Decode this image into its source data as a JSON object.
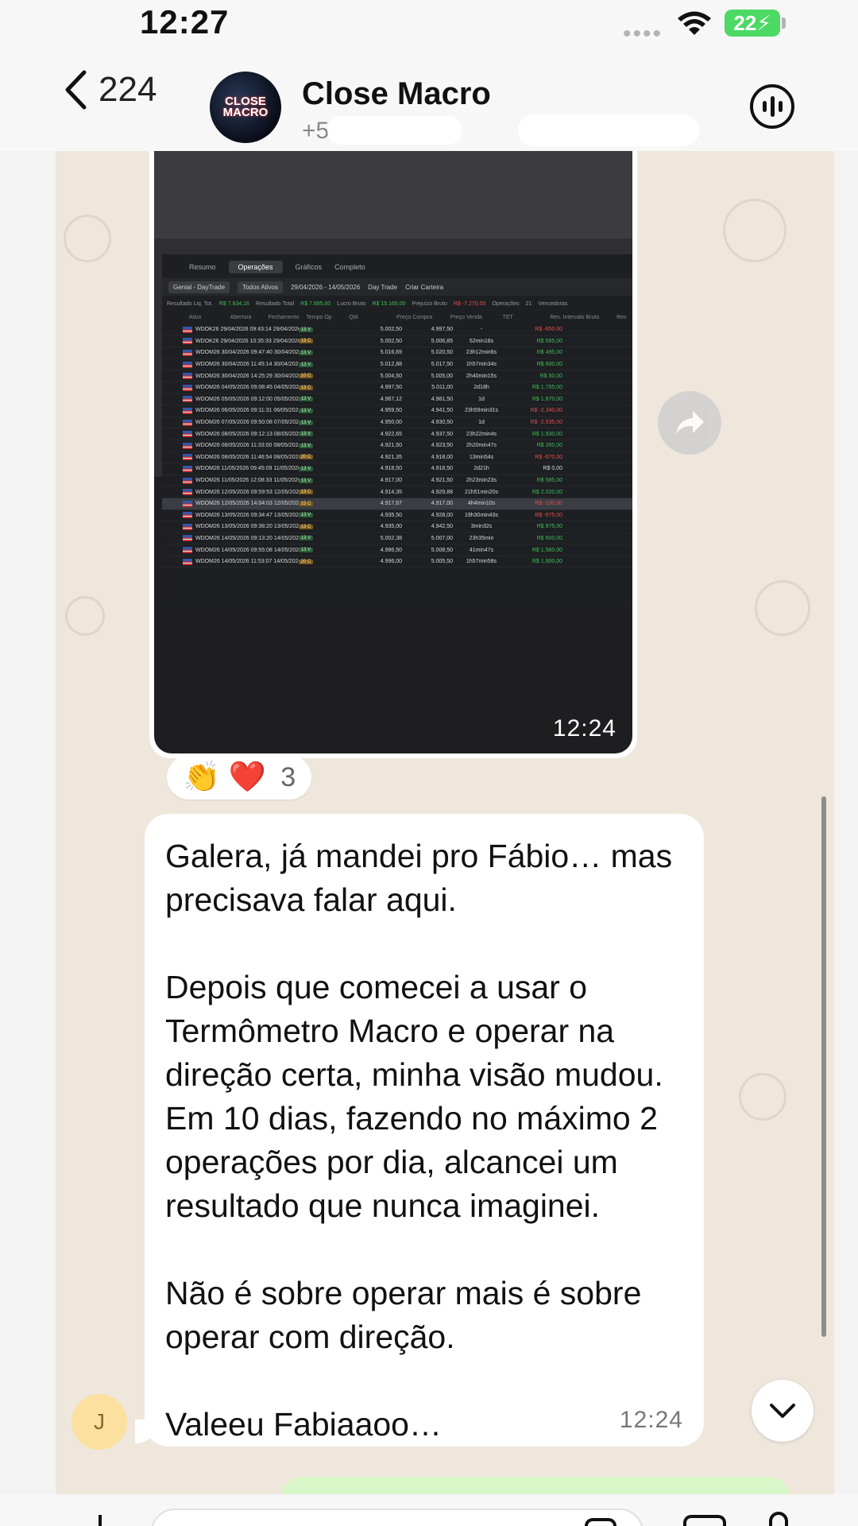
{
  "status_bar": {
    "time": "12:27",
    "battery": "22"
  },
  "header": {
    "back_count": "224",
    "contact_name": "Close Macro",
    "contact_sub": "+5 19,",
    "avatar_text": "CLOSE MACRO"
  },
  "image_message": {
    "time": "12:24",
    "screenshot": {
      "tabs": [
        "Resumo",
        "Operações",
        "Gráficos",
        "Completo"
      ],
      "active_tab": "Operações",
      "toolbar": {
        "account": "Genial - DayTrade",
        "assets": "Todos Ativos",
        "date_range": "29/04/2026 - 14/05/2026",
        "day_trade": "Day Trade",
        "create_wallet": "Criar Carteira"
      },
      "summary": [
        {
          "label": "Resultado Liq. Tot.",
          "value": "R$ 7.834,16",
          "tone": "pos"
        },
        {
          "label": "Resultado Total",
          "value": "R$ 7.895,00",
          "tone": "pos"
        },
        {
          "label": "Lucro Bruto",
          "value": "R$ 15.165,00",
          "tone": "pos"
        },
        {
          "label": "Prejuízo Bruto",
          "value": "R$ -7.270,00",
          "tone": "neg"
        },
        {
          "label": "Operações",
          "value": "21",
          "tone": ""
        },
        {
          "label": "Vencedoras",
          "value": "",
          "tone": ""
        }
      ],
      "columns": [
        "Ativo",
        "Abertura",
        "Fechamento",
        "Tempo Op",
        "Qtd",
        "Preço Compra",
        "Preço Venda",
        "TET",
        "Res. Intervalo Bruto",
        "Res"
      ],
      "rows": [
        {
          "ativo": "WDOK26 29/04/2026 09:43:14 29/04/2026 10:35:52min15s",
          "qtd": "13 V",
          "side": "v",
          "compra": "5.002,50",
          "venda": "4.997,50",
          "tet": "-",
          "res": "R$ -650,00",
          "tone": "neg"
        },
        {
          "ativo": "WDOK26 29/04/2026 10:35:33 29/04/2026 17:03:6h27min",
          "qtd": "13 C",
          "side": "c",
          "compra": "5.002,50",
          "venda": "5.006,85",
          "tet": "52min18s",
          "res": "R$ 565,00",
          "tone": "pos"
        },
        {
          "ativo": "WDOM26 30/04/2026 09:47:40 30/04/2026 11:37:1h49min",
          "qtd": "13 V",
          "side": "v",
          "compra": "5.016,69",
          "venda": "5.020,50",
          "tet": "23h12min6s",
          "res": "R$ 495,00",
          "tone": "pos"
        },
        {
          "ativo": "WDOM26 30/04/2026 11:45:14 30/04/2026 13:01:1h16min",
          "qtd": "13 V",
          "side": "v",
          "compra": "5.012,88",
          "venda": "5.017,50",
          "tet": "1h57min34s",
          "res": "R$ 600,00",
          "tone": "pos"
        },
        {
          "ativo": "WDOM26 30/04/2026 14:25:29 30/04/2026 14:29 3min59s",
          "qtd": "10 C",
          "side": "c",
          "compra": "5.004,50",
          "venda": "5.005,00",
          "tet": "2h40min15s",
          "res": "R$ 50,00",
          "tone": "pos"
        },
        {
          "ativo": "WDOM26 04/05/2026 09:08:45 04/05/2026 14:01:4h53min",
          "qtd": "13 C",
          "side": "c",
          "compra": "4.997,50",
          "venda": "5.011,00",
          "tet": "2d18h",
          "res": "R$ 1.755,00",
          "tone": "pos"
        },
        {
          "ativo": "WDOM26 05/05/2026 09:12:00 05/05/2026 10:19:1h7min",
          "qtd": "13 V",
          "side": "v",
          "compra": "4.967,12",
          "venda": "4.981,50",
          "tet": "1d",
          "res": "R$ 1.870,00",
          "tone": "pos"
        },
        {
          "ativo": "WDOM26 06/05/2026 09:11:31 06/05/2026 10:00 49min",
          "qtd": "13 V",
          "side": "v",
          "compra": "4.959,50",
          "venda": "4.941,50",
          "tet": "23h59min31s",
          "res": "R$ -2.340,00",
          "tone": "neg"
        },
        {
          "ativo": "WDOM26 07/05/2026 09:50:08 07/05/2026 11:03:1h13min",
          "qtd": "13 V",
          "side": "v",
          "compra": "4.950,00",
          "venda": "4.930,50",
          "tet": "1d",
          "res": "R$ -2.535,00",
          "tone": "neg"
        },
        {
          "ativo": "WDOM26 08/05/2026 09:12:13 08/05/2026 10:34:1h21min",
          "qtd": "13 V",
          "side": "v",
          "compra": "4.922,65",
          "venda": "4.937,50",
          "tet": "23h22min4s",
          "res": "R$ 1.930,00",
          "tone": "pos"
        },
        {
          "ativo": "WDOM26 08/05/2026 11:33:00 08/05/2026 11:46 13min53s",
          "qtd": "13 V",
          "side": "v",
          "compra": "4.921,50",
          "venda": "4.923,50",
          "tet": "2h20min47s",
          "res": "R$ 260,00",
          "tone": "pos"
        },
        {
          "ativo": "WDOM26 08/05/2026 11:46:54 08/05/2026 17:34:5h47min",
          "qtd": "20 C",
          "side": "c",
          "compra": "4.921,35",
          "venda": "4.918,00",
          "tet": "13min54s",
          "res": "R$ -670,00",
          "tone": "neg"
        },
        {
          "ativo": "WDOM26 11/05/2026 09:45:09 11/05/2026 11:48:2h3min",
          "qtd": "13 V",
          "side": "v",
          "compra": "4.918,50",
          "venda": "4.918,50",
          "tet": "2d21h",
          "res": "R$ 0,00",
          "tone": "zero"
        },
        {
          "ativo": "WDOM26 11/05/2026 12:08:33 11/05/2026 17:29:5h21min",
          "qtd": "13 V",
          "side": "v",
          "compra": "4.917,00",
          "venda": "4.921,50",
          "tet": "2h23min23s",
          "res": "R$ 585,00",
          "tone": "pos"
        },
        {
          "ativo": "WDOM26 12/05/2026 09:59:53 12/05/2026 12:16:2h16min",
          "qtd": "13 C",
          "side": "c",
          "compra": "4.914,35",
          "venda": "4.929,88",
          "tet": "21h51min20s",
          "res": "R$ 2.020,00",
          "tone": "pos"
        },
        {
          "ativo": "WDOM26 12/05/2026 14:04:03 12/05/2026 17:22:3h18min",
          "qtd": "15 C",
          "side": "c",
          "compra": "4.917,67",
          "venda": "4.917,00",
          "tet": "4h4min10s",
          "res": "R$ -100,00",
          "tone": "neg",
          "selected": true
        },
        {
          "ativo": "WDOM26 13/05/2026 09:34:47 13/05/2026 09:38 3min28s",
          "qtd": "13 V",
          "side": "v",
          "compra": "4.935,50",
          "venda": "4.928,00",
          "tet": "19h30min43s",
          "res": "R$ -975,00",
          "tone": "neg"
        },
        {
          "ativo": "WDOM26 13/05/2026 09:38:20 13/05/2026 09:53 15min16s",
          "qtd": "13 C",
          "side": "c",
          "compra": "4.935,00",
          "venda": "4.942,50",
          "tet": "3min32s",
          "res": "R$ 975,00",
          "tone": "pos"
        },
        {
          "ativo": "WDOM26 14/05/2026 09:13:20 14/05/2026 09:46 33min59s",
          "qtd": "13 V",
          "side": "v",
          "compra": "5.002,38",
          "venda": "5.007,00",
          "tet": "23h35min",
          "res": "R$ 600,00",
          "tone": "pos"
        },
        {
          "ativo": "WDOM26 14/05/2026 09:55:08 14/05/2026 10:12 17min34s",
          "qtd": "13 V",
          "side": "v",
          "compra": "4.996,50",
          "venda": "5.008,50",
          "tet": "41min47s",
          "res": "R$ 1.560,00",
          "tone": "pos"
        },
        {
          "ativo": "WDOM26 14/05/2026 11:53:07 14/05/2026 12:04 11min7s",
          "qtd": "20 C",
          "side": "c",
          "compra": "4.996,00",
          "venda": "5.005,50",
          "tet": "1h57min58s",
          "res": "R$ 1.900,00",
          "tone": "pos"
        }
      ]
    }
  },
  "reactions": {
    "emojis": "👏 ❤️",
    "count": "3"
  },
  "text_message": {
    "text": "Galera, já mandei pro Fábio… mas precisava falar aqui.\n\nDepois que comecei a usar o Termômetro Macro e operar na direção certa, minha visão mudou. Em 10 dias, fazendo no máximo 2 operações por dia, alcancei um resultado que nunca imaginei.\n\nNão é sobre operar mais é sobre operar com direção.\n\nValeeu Fabiaaoo…",
    "time": "12:24",
    "sender_initial": "J"
  }
}
